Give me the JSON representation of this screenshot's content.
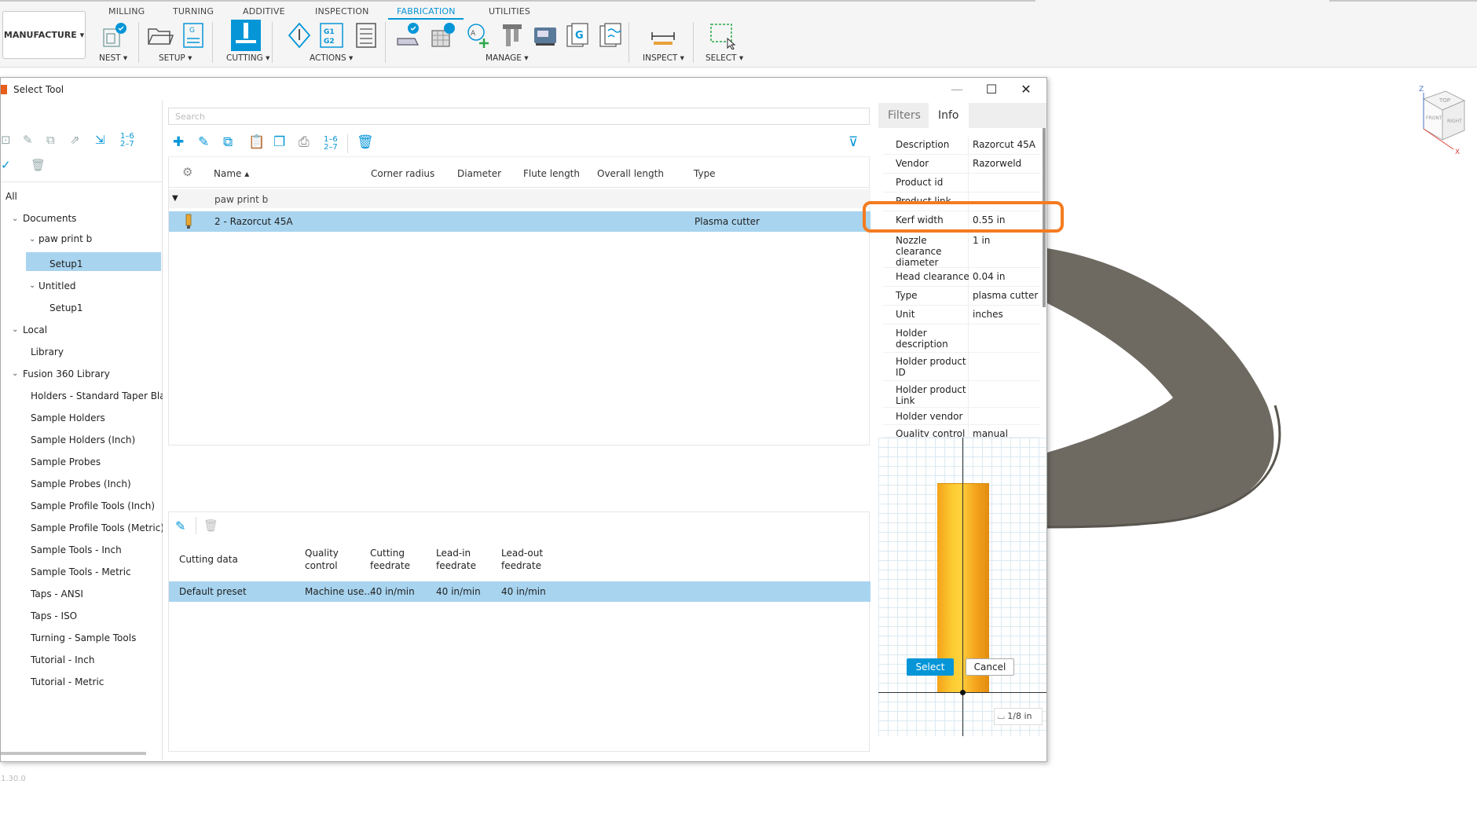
{
  "ribbon": {
    "tabs": [
      "MILLING",
      "TURNING",
      "ADDITIVE",
      "INSPECTION",
      "FABRICATION",
      "UTILITIES"
    ],
    "active_tab": "FABRICATION",
    "workspace": "MANUFACTURE ▾",
    "groups": [
      "NEST ▾",
      "SETUP ▾",
      "CUTTING ▾",
      "ACTIONS ▾",
      "MANAGE ▾",
      "INSPECT ▾",
      "SELECT ▾"
    ],
    "accent": "#0696d7"
  },
  "dialog": {
    "title": "Select Tool",
    "version": "1.30.0"
  },
  "library": {
    "all": "All",
    "documents": "Documents",
    "doc1": "paw print b",
    "doc1_setup": "Setup1",
    "doc2": "Untitled",
    "doc2_setup": "Setup1",
    "local": "Local",
    "local_lib": "Library",
    "fusion": "Fusion 360 Library",
    "fusion_items": [
      "Holders - Standard Taper Blanks",
      "Sample Holders",
      "Sample Holders (Inch)",
      "Sample Probes",
      "Sample Probes (Inch)",
      "Sample Profile Tools (Inch)",
      "Sample Profile Tools (Metric)",
      "Sample Tools - Inch",
      "Sample Tools - Metric",
      "Taps - ANSI",
      "Taps - ISO",
      "Turning - Sample Tools",
      "Tutorial - Inch",
      "Tutorial - Metric"
    ]
  },
  "tools": {
    "search_placeholder": "Search",
    "columns": [
      "Name ▴",
      "Corner radius",
      "Diameter",
      "Flute length",
      "Overall length",
      "Type"
    ],
    "group": "paw print b",
    "row": {
      "name": "2 - Razorcut 45A",
      "type": "Plasma cutter"
    }
  },
  "cutting": {
    "columns": [
      "Cutting data",
      "Quality\ncontrol",
      "Cutting\nfeedrate",
      "Lead-in\nfeedrate",
      "Lead-out\nfeedrate"
    ],
    "row": [
      "Default preset",
      "Machine use...",
      "40 in/min",
      "40 in/min",
      "40 in/min"
    ]
  },
  "info": {
    "tab_filters": "Filters",
    "tab_info": "Info",
    "rows": [
      {
        "label": "Description",
        "value": "Razorcut 45A"
      },
      {
        "label": "Vendor",
        "value": "Razorweld"
      },
      {
        "label": "Product id",
        "value": ""
      },
      {
        "label": "Product link",
        "value": ""
      },
      {
        "label": "Kerf width",
        "value": "0.55 in"
      },
      {
        "label": "Nozzle\nclearance\ndiameter",
        "value": "1 in"
      },
      {
        "label": "Head clearance",
        "value": "0.04 in"
      },
      {
        "label": "Type",
        "value": "plasma cutter"
      },
      {
        "label": "Unit",
        "value": "inches"
      },
      {
        "label": "Holder\ndescription",
        "value": ""
      },
      {
        "label": "Holder product\nID",
        "value": ""
      },
      {
        "label": "Holder product\nLink",
        "value": ""
      },
      {
        "label": "Holder vendor",
        "value": ""
      },
      {
        "label": "Quality control",
        "value": "manual"
      }
    ],
    "scale": "⌴ 1/8 in"
  },
  "buttons": {
    "select": "Select",
    "cancel": "Cancel"
  },
  "viewcube": {
    "top": "TOP",
    "front": "FRONT",
    "right": "RIGHT",
    "z": "Z",
    "x": "X"
  },
  "highlight_color": "#f47b20"
}
